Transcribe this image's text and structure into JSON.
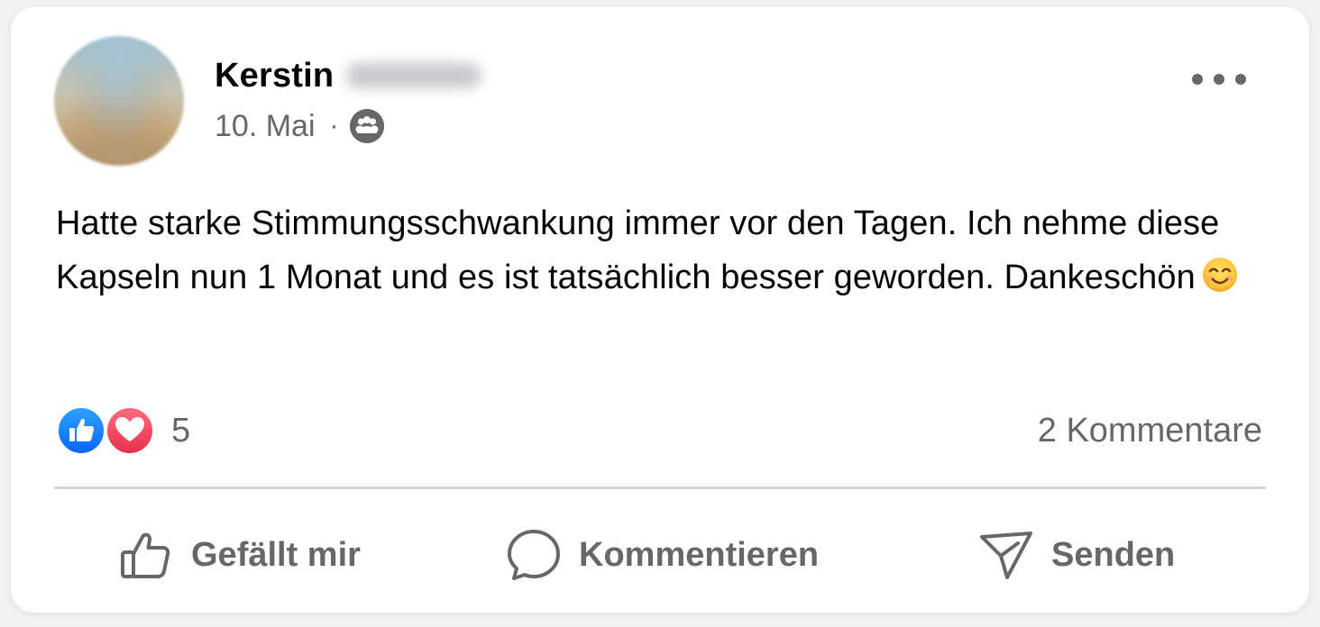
{
  "post": {
    "author": {
      "name": "Kerstin"
    },
    "date": "10. Mai",
    "separator": "·",
    "audience_icon": "group-audience-icon",
    "text": "Hatte starke Stimmungsschwankung immer vor den Tagen. Ich nehme diese Kapseln nun 1 Monat und es ist tatsächlich besser geworden. Dankeschön"
  },
  "stats": {
    "reaction_count": "5",
    "reaction_types": [
      "like",
      "love"
    ],
    "comments": "2 Kommentare"
  },
  "actions": {
    "like": "Gefällt mir",
    "comment": "Kommentieren",
    "send": "Senden"
  },
  "colors": {
    "like_blue": "#0866ff",
    "love_red": "#f02849",
    "secondary_text": "#65676b",
    "primary_text": "#050505"
  }
}
